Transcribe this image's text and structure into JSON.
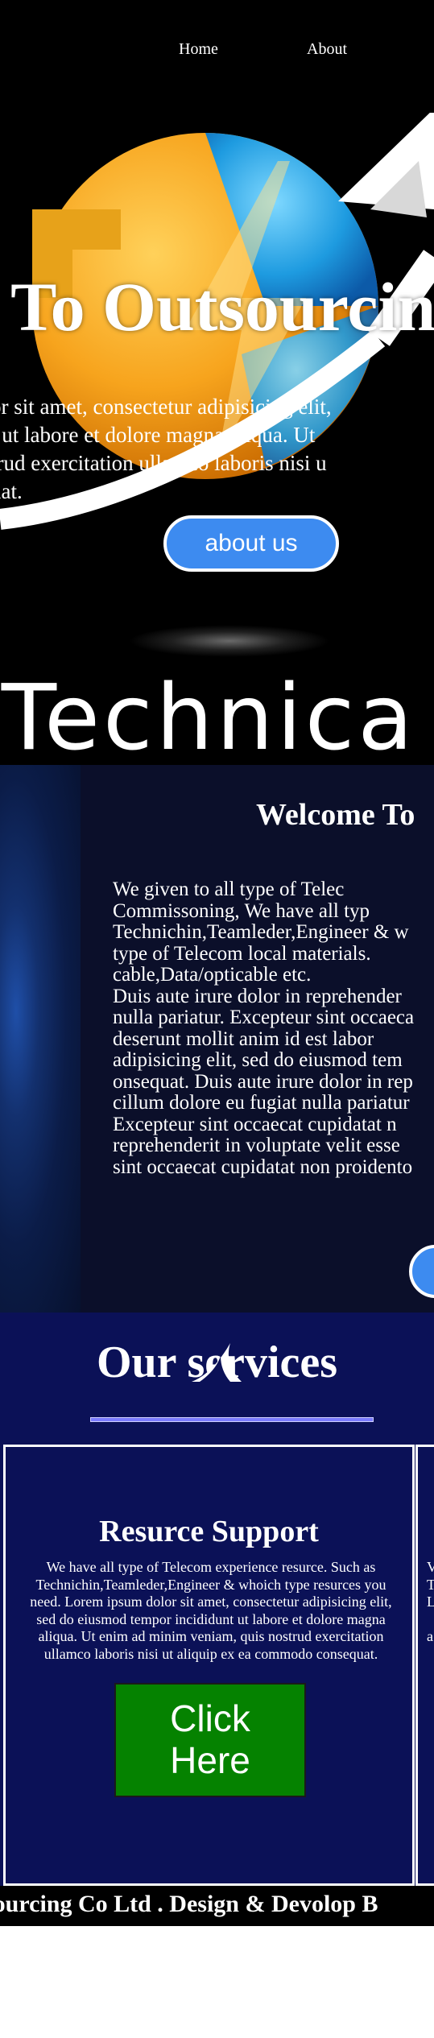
{
  "nav": {
    "items": [
      {
        "label": "Home"
      },
      {
        "label": "About"
      }
    ]
  },
  "hero": {
    "title": "e To Outsourcing",
    "text_lines": [
      "or sit amet, consectetur adipisicing elit,",
      "t ut labore et dolore magna aliqua. Ut",
      "trud exercitation ullamco laboris nisi u",
      "uat."
    ],
    "about_button": "about us",
    "brand_accent": ":",
    "brand_text": "Technica"
  },
  "welcome": {
    "title": "Welcome To",
    "text_lines": [
      "We given to all type of Telec",
      "Commissoning, We have all typ",
      "Technichin,Teamleder,Engineer & w",
      "type of Telecom local materials.",
      "cable,Data/opticable etc.",
      "Duis aute irure dolor in reprehender",
      "nulla pariatur. Excepteur sint occaeca",
      "deserunt mollit anim id est labor",
      "adipisicing elit, sed do eiusmod tem",
      "onsequat. Duis aute irure dolor in rep",
      "cillum dolore eu fugiat nulla pariatur",
      "Excepteur sint occaecat cupidatat n",
      "reprehenderit in voluptate velit esse",
      "sint occaecat cupidatat non proidento"
    ]
  },
  "services": {
    "title": "Our services",
    "card": {
      "title": "Resurce Support",
      "text_lines": [
        "We have all type of Telecom experience resurce. Such as",
        "Technichin,Teamleder,Engineer & whoich type resurces you",
        "need. Lorem ipsum dolor sit amet, consectetur adipisicing elit,",
        "sed do eiusmod tempor incididunt ut labore et dolore magna",
        "aliqua. Ut enim ad minim veniam, quis nostrud exercitation",
        "ullamco laboris nisi ut aliquip ex ea commodo consequat."
      ],
      "button_line1": "Click",
      "button_line2": "Here"
    },
    "card2_text_lines": [
      "V",
      "T",
      "L",
      "",
      "a"
    ]
  },
  "footer": {
    "text": "tsourcing Co Ltd . Design & Devolop B"
  },
  "colors": {
    "accent_blue": "#3d8bf0",
    "navy": "#0b1157",
    "green": "#058200",
    "yellow": "#f5c400"
  },
  "icons": [
    "globe-logo-graphic",
    "arrow-graphic",
    "shark-fin-icon"
  ]
}
